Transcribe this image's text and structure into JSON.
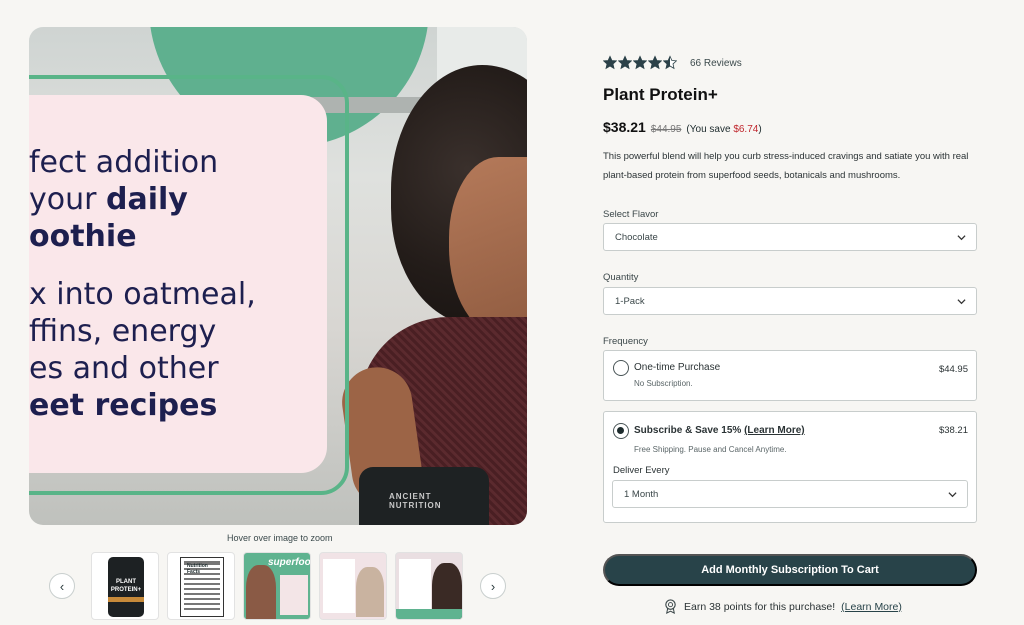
{
  "gallery": {
    "hero_lines": [
      {
        "normal": "fect addition",
        "bold": ""
      },
      {
        "normal": "your ",
        "bold": "daily"
      },
      {
        "normal": "",
        "bold": "oothie"
      },
      {
        "normal": "x into oatmeal,",
        "bold": ""
      },
      {
        "normal": "ffins, energy",
        "bold": ""
      },
      {
        "normal": "es and other",
        "bold": ""
      },
      {
        "normal": "",
        "bold": "eet recipes"
      }
    ],
    "jar_brand": "ANCIENT NUTRITION",
    "zoom_hint": "Hover over image to zoom",
    "prev_icon": "‹",
    "next_icon": "›",
    "thumb1_brand": "PLANT",
    "thumb1_name": "PROTEIN+",
    "thumb2_header": "Nutrition Facts",
    "thumb3_word": "superfood"
  },
  "product": {
    "rating": 4.5,
    "reviews_label": "66 Reviews",
    "name": "Plant Protein+",
    "price": "$38.21",
    "old_price": "$44.95",
    "save_prefix": "(You save ",
    "save_amount": "$6.74",
    "save_suffix": ")",
    "description": "This powerful blend will help you curb stress-induced cravings and satiate you with real plant-based protein from superfood seeds, botanicals and mushrooms."
  },
  "options": {
    "flavor_label": "Select Flavor",
    "flavor_value": "Chocolate",
    "quantity_label": "Quantity",
    "quantity_value": "1-Pack",
    "frequency_label": "Frequency",
    "one_time": {
      "title": "One-time Purchase",
      "sub": "No Subscription.",
      "price": "$44.95"
    },
    "subscribe": {
      "title": "Subscribe & Save 15%",
      "learn_more": "(Learn More)",
      "sub": "Free Shipping. Pause and Cancel Anytime.",
      "price": "$38.21",
      "deliver_label": "Deliver Every",
      "deliver_value": "1 Month"
    }
  },
  "cta": {
    "label": "Add Monthly Subscription To Cart"
  },
  "points": {
    "text": "Earn 38 points for this purchase!",
    "learn_more": "(Learn More)"
  },
  "colors": {
    "cta_bg": "#284349",
    "star": "#2b4148",
    "sale_red": "#c0262d",
    "accent_green": "#59b488",
    "hero_text": "#1d1f4f"
  }
}
